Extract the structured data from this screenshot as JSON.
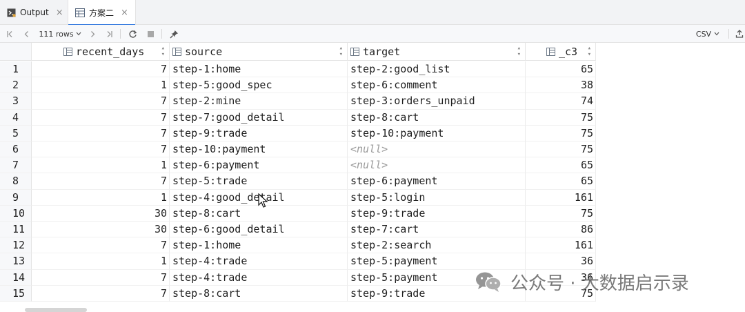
{
  "tabs": [
    {
      "label": "Output",
      "close": "×"
    },
    {
      "label": "方案二",
      "close": "×"
    }
  ],
  "toolbar": {
    "rows_label": "111 rows",
    "export_label": "CSV"
  },
  "columns": [
    {
      "name": "recent_days"
    },
    {
      "name": "source"
    },
    {
      "name": "target"
    },
    {
      "name": "_c3"
    }
  ],
  "rows": [
    {
      "n": "1",
      "recent_days": "7",
      "source": "step-1:home",
      "target": "step-2:good_list",
      "c3": "65"
    },
    {
      "n": "2",
      "recent_days": "1",
      "source": "step-5:good_spec",
      "target": "step-6:comment",
      "c3": "38"
    },
    {
      "n": "3",
      "recent_days": "7",
      "source": "step-2:mine",
      "target": "step-3:orders_unpaid",
      "c3": "74"
    },
    {
      "n": "4",
      "recent_days": "7",
      "source": "step-7:good_detail",
      "target": "step-8:cart",
      "c3": "75"
    },
    {
      "n": "5",
      "recent_days": "7",
      "source": "step-9:trade",
      "target": "step-10:payment",
      "c3": "75"
    },
    {
      "n": "6",
      "recent_days": "7",
      "source": "step-10:payment",
      "target": "<null>",
      "c3": "75"
    },
    {
      "n": "7",
      "recent_days": "1",
      "source": "step-6:payment",
      "target": "<null>",
      "c3": "65"
    },
    {
      "n": "8",
      "recent_days": "7",
      "source": "step-5:trade",
      "target": "step-6:payment",
      "c3": "65"
    },
    {
      "n": "9",
      "recent_days": "1",
      "source": "step-4:good_detail",
      "target": "step-5:login",
      "c3": "161"
    },
    {
      "n": "10",
      "recent_days": "30",
      "source": "step-8:cart",
      "target": "step-9:trade",
      "c3": "75"
    },
    {
      "n": "11",
      "recent_days": "30",
      "source": "step-6:good_detail",
      "target": "step-7:cart",
      "c3": "86"
    },
    {
      "n": "12",
      "recent_days": "7",
      "source": "step-1:home",
      "target": "step-2:search",
      "c3": "161"
    },
    {
      "n": "13",
      "recent_days": "1",
      "source": "step-4:trade",
      "target": "step-5:payment",
      "c3": "36"
    },
    {
      "n": "14",
      "recent_days": "7",
      "source": "step-4:trade",
      "target": "step-5:payment",
      "c3": "36"
    },
    {
      "n": "15",
      "recent_days": "7",
      "source": "step-8:cart",
      "target": "step-9:trade",
      "c3": "75"
    }
  ],
  "watermark": {
    "text": "公众号 · 大数据启示录"
  },
  "colors": {
    "accent": "#3d7fe0",
    "null_text": "#9a9a9a",
    "header_bg": "#f2f3f5"
  }
}
